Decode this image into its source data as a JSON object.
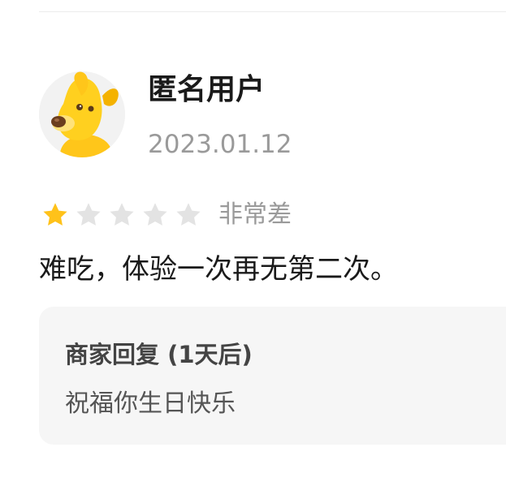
{
  "review": {
    "user": {
      "name": "匿名用户",
      "avatar_icon": "yellow-dog-mascot-icon"
    },
    "date": "2023.01.12",
    "rating": {
      "value": 1,
      "max": 5,
      "label": "非常差",
      "filled_color": "#FFC21A",
      "empty_color": "#E3E3E3"
    },
    "text": "难吃，体验一次再无第二次。"
  },
  "merchant_reply": {
    "title": "商家回复 (1天后)",
    "content": "祝福你生日快乐"
  }
}
